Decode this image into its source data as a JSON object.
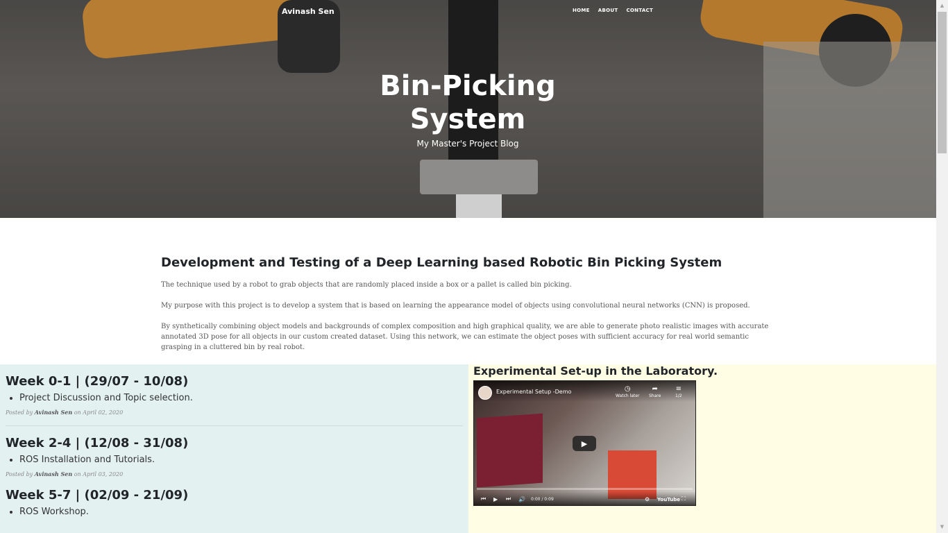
{
  "header": {
    "brand": "Avinash Sen",
    "nav": [
      "HOME",
      "ABOUT",
      "CONTACT"
    ],
    "title_line1": "Bin-Picking",
    "title_line2": "System",
    "subtitle": "My Master's Project Blog"
  },
  "intro": {
    "heading": "Development and Testing of a Deep Learning based Robotic Bin Picking System",
    "paragraphs": [
      "The technique used by a robot to grab objects that are randomly placed inside a box or a pallet is called bin picking.",
      "My purpose with this project is to develop a system that is based on learning the appearance model of objects using convolutional neural networks (CNN) is proposed.",
      "By synthetically combining object models and backgrounds of complex composition and high graphical quality, we are able to generate photo realistic images with accurate annotated 3D pose for all objects in our custom created dataset. Using this network, we can estimate the object poses with sufficient accuracy for real world semantic grasping in a cluttered bin by real robot."
    ]
  },
  "posts": [
    {
      "title": "Week 0-1 | (29/07 - 10/08)",
      "item": "Project Discussion and Topic selection.",
      "meta_prefix": "Posted by",
      "author": "Avinash Sen",
      "meta_on": "on",
      "date": "April 02, 2020"
    },
    {
      "title": "Week 2-4 | (12/08 - 31/08)",
      "item": "ROS Installation and Tutorials.",
      "meta_prefix": "Posted by",
      "author": "Avinash Sen",
      "meta_on": "on",
      "date": "April 03, 2020"
    },
    {
      "title": "Week 5-7 | (02/09 - 21/09)",
      "item": "ROS Workshop."
    }
  ],
  "video_section": {
    "heading": "Experimental Set-up in the Laboratory.",
    "video_title": "Experimental Setup -Demo",
    "watch_later": "Watch later",
    "share": "Share",
    "playlist": "1/2",
    "time": "0:00 / 0:09",
    "logo": "YouTube",
    "progress": 0
  },
  "icons": {
    "play": "play-icon",
    "clock": "clock-icon",
    "share": "share-icon",
    "playlist": "playlist-icon",
    "settings": "gear-icon",
    "fullscreen": "fullscreen-icon"
  }
}
